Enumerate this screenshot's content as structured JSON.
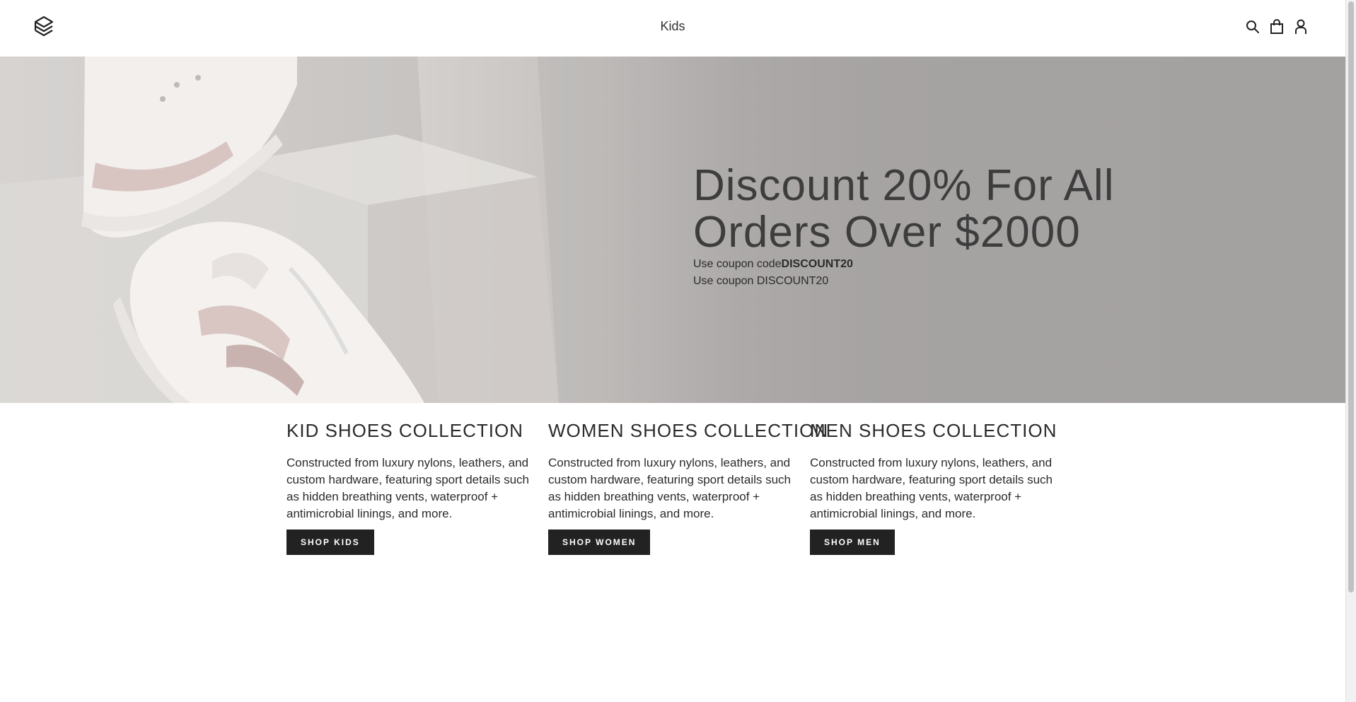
{
  "header": {
    "nav_title": "Kids",
    "icons": [
      "search-icon",
      "bag-icon",
      "account-icon"
    ]
  },
  "hero": {
    "heading": "Discount 20% For All Orders Over $2000",
    "coupon_prefix": "Use coupon code",
    "coupon_code": "DISCOUNT20",
    "coupon_line2": "Use coupon DISCOUNT20",
    "image": "white and pink sneakers on white display cubes"
  },
  "collections": [
    {
      "title": "KID SHOES COLLECTION",
      "description": "Constructed from luxury nylons, leathers, and custom hardware, featuring sport details such as hidden breathing vents, waterproof + antimicrobial linings, and more.",
      "button": "SHOP KIDS"
    },
    {
      "title": "WOMEN SHOES COLLECTION",
      "description": "Constructed from luxury nylons, leathers, and custom hardware, featuring sport details such as hidden breathing vents, waterproof + antimicrobial linings, and more.",
      "button": "SHOP WOMEN"
    },
    {
      "title": "MEN SHOES COLLECTION",
      "description": "Constructed from luxury nylons, leathers, and custom hardware, featuring sport details such as hidden breathing vents, waterproof + antimicrobial linings, and more.",
      "button": "SHOP MEN"
    }
  ],
  "colors": {
    "button_bg": "#222222",
    "hero_bg": "#a6a3a2",
    "text": "#2b2b2b"
  }
}
